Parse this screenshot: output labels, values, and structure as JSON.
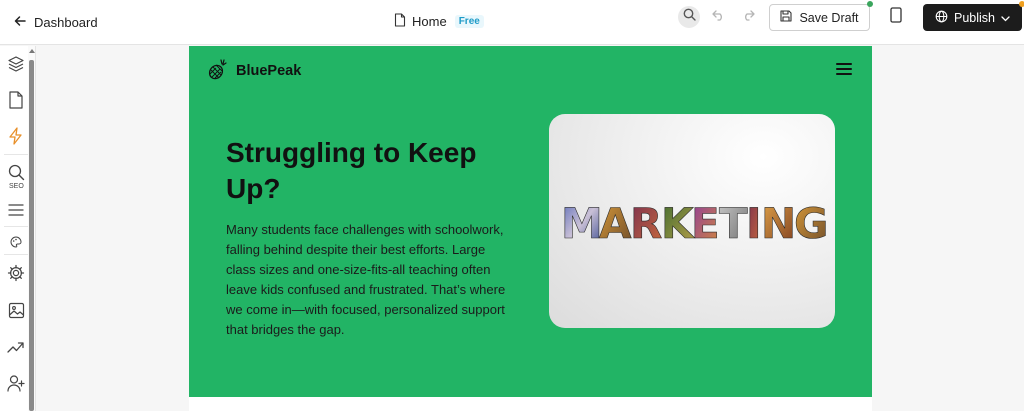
{
  "topbar": {
    "back_label": "Dashboard",
    "page_name": "Home",
    "plan_badge": "Free",
    "save_label": "Save Draft",
    "publish_label": "Publish"
  },
  "sidebar": {
    "seo_label": "SEO",
    "icons": [
      "layers-icon",
      "page-icon",
      "lightning-icon",
      "seo-search-icon",
      "menu-lines-icon",
      "palette-icon",
      "settings-icon",
      "image-icon",
      "analytics-icon",
      "add-user-icon"
    ]
  },
  "site": {
    "brand": "BluePeak",
    "hero_title": "Struggling to Keep Up?",
    "hero_text": "Many students face challenges with schoolwork, falling behind despite their best efforts. Large class sizes and one-size-fits-all teaching often leave kids confused and frustrated. That’s where we come in—with focused, personalized support that bridges the gap.",
    "hero_image_text": "MARKETING"
  },
  "colors": {
    "accent_green": "#22b465",
    "publish_bg": "#1c1c1c",
    "badge_blue": "#1e9bc8",
    "lightning_orange": "#e8902a"
  }
}
